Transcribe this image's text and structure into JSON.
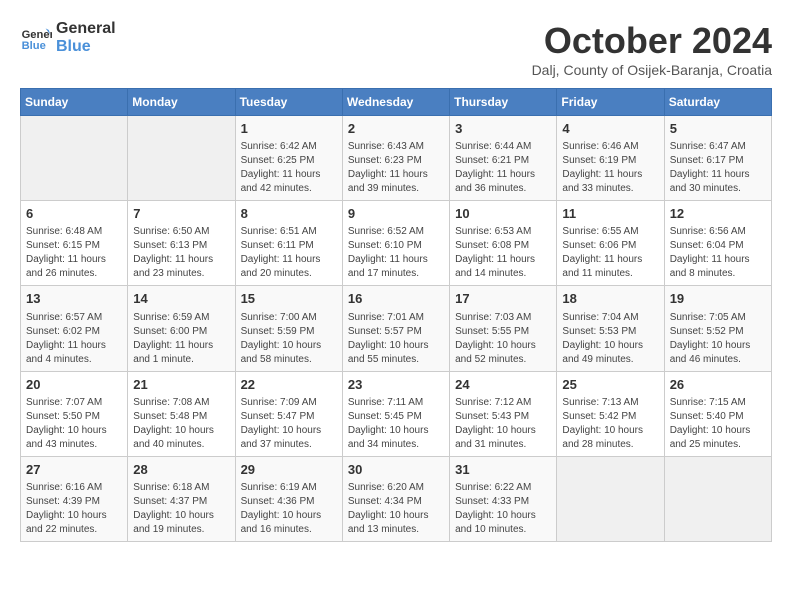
{
  "logo": {
    "line1": "General",
    "line2": "Blue"
  },
  "title": "October 2024",
  "subtitle": "Dalj, County of Osijek-Baranja, Croatia",
  "days_of_week": [
    "Sunday",
    "Monday",
    "Tuesday",
    "Wednesday",
    "Thursday",
    "Friday",
    "Saturday"
  ],
  "weeks": [
    [
      {
        "day": "",
        "content": ""
      },
      {
        "day": "",
        "content": ""
      },
      {
        "day": "1",
        "content": "Sunrise: 6:42 AM\nSunset: 6:25 PM\nDaylight: 11 hours and 42 minutes."
      },
      {
        "day": "2",
        "content": "Sunrise: 6:43 AM\nSunset: 6:23 PM\nDaylight: 11 hours and 39 minutes."
      },
      {
        "day": "3",
        "content": "Sunrise: 6:44 AM\nSunset: 6:21 PM\nDaylight: 11 hours and 36 minutes."
      },
      {
        "day": "4",
        "content": "Sunrise: 6:46 AM\nSunset: 6:19 PM\nDaylight: 11 hours and 33 minutes."
      },
      {
        "day": "5",
        "content": "Sunrise: 6:47 AM\nSunset: 6:17 PM\nDaylight: 11 hours and 30 minutes."
      }
    ],
    [
      {
        "day": "6",
        "content": "Sunrise: 6:48 AM\nSunset: 6:15 PM\nDaylight: 11 hours and 26 minutes."
      },
      {
        "day": "7",
        "content": "Sunrise: 6:50 AM\nSunset: 6:13 PM\nDaylight: 11 hours and 23 minutes."
      },
      {
        "day": "8",
        "content": "Sunrise: 6:51 AM\nSunset: 6:11 PM\nDaylight: 11 hours and 20 minutes."
      },
      {
        "day": "9",
        "content": "Sunrise: 6:52 AM\nSunset: 6:10 PM\nDaylight: 11 hours and 17 minutes."
      },
      {
        "day": "10",
        "content": "Sunrise: 6:53 AM\nSunset: 6:08 PM\nDaylight: 11 hours and 14 minutes."
      },
      {
        "day": "11",
        "content": "Sunrise: 6:55 AM\nSunset: 6:06 PM\nDaylight: 11 hours and 11 minutes."
      },
      {
        "day": "12",
        "content": "Sunrise: 6:56 AM\nSunset: 6:04 PM\nDaylight: 11 hours and 8 minutes."
      }
    ],
    [
      {
        "day": "13",
        "content": "Sunrise: 6:57 AM\nSunset: 6:02 PM\nDaylight: 11 hours and 4 minutes."
      },
      {
        "day": "14",
        "content": "Sunrise: 6:59 AM\nSunset: 6:00 PM\nDaylight: 11 hours and 1 minute."
      },
      {
        "day": "15",
        "content": "Sunrise: 7:00 AM\nSunset: 5:59 PM\nDaylight: 10 hours and 58 minutes."
      },
      {
        "day": "16",
        "content": "Sunrise: 7:01 AM\nSunset: 5:57 PM\nDaylight: 10 hours and 55 minutes."
      },
      {
        "day": "17",
        "content": "Sunrise: 7:03 AM\nSunset: 5:55 PM\nDaylight: 10 hours and 52 minutes."
      },
      {
        "day": "18",
        "content": "Sunrise: 7:04 AM\nSunset: 5:53 PM\nDaylight: 10 hours and 49 minutes."
      },
      {
        "day": "19",
        "content": "Sunrise: 7:05 AM\nSunset: 5:52 PM\nDaylight: 10 hours and 46 minutes."
      }
    ],
    [
      {
        "day": "20",
        "content": "Sunrise: 7:07 AM\nSunset: 5:50 PM\nDaylight: 10 hours and 43 minutes."
      },
      {
        "day": "21",
        "content": "Sunrise: 7:08 AM\nSunset: 5:48 PM\nDaylight: 10 hours and 40 minutes."
      },
      {
        "day": "22",
        "content": "Sunrise: 7:09 AM\nSunset: 5:47 PM\nDaylight: 10 hours and 37 minutes."
      },
      {
        "day": "23",
        "content": "Sunrise: 7:11 AM\nSunset: 5:45 PM\nDaylight: 10 hours and 34 minutes."
      },
      {
        "day": "24",
        "content": "Sunrise: 7:12 AM\nSunset: 5:43 PM\nDaylight: 10 hours and 31 minutes."
      },
      {
        "day": "25",
        "content": "Sunrise: 7:13 AM\nSunset: 5:42 PM\nDaylight: 10 hours and 28 minutes."
      },
      {
        "day": "26",
        "content": "Sunrise: 7:15 AM\nSunset: 5:40 PM\nDaylight: 10 hours and 25 minutes."
      }
    ],
    [
      {
        "day": "27",
        "content": "Sunrise: 6:16 AM\nSunset: 4:39 PM\nDaylight: 10 hours and 22 minutes."
      },
      {
        "day": "28",
        "content": "Sunrise: 6:18 AM\nSunset: 4:37 PM\nDaylight: 10 hours and 19 minutes."
      },
      {
        "day": "29",
        "content": "Sunrise: 6:19 AM\nSunset: 4:36 PM\nDaylight: 10 hours and 16 minutes."
      },
      {
        "day": "30",
        "content": "Sunrise: 6:20 AM\nSunset: 4:34 PM\nDaylight: 10 hours and 13 minutes."
      },
      {
        "day": "31",
        "content": "Sunrise: 6:22 AM\nSunset: 4:33 PM\nDaylight: 10 hours and 10 minutes."
      },
      {
        "day": "",
        "content": ""
      },
      {
        "day": "",
        "content": ""
      }
    ]
  ]
}
